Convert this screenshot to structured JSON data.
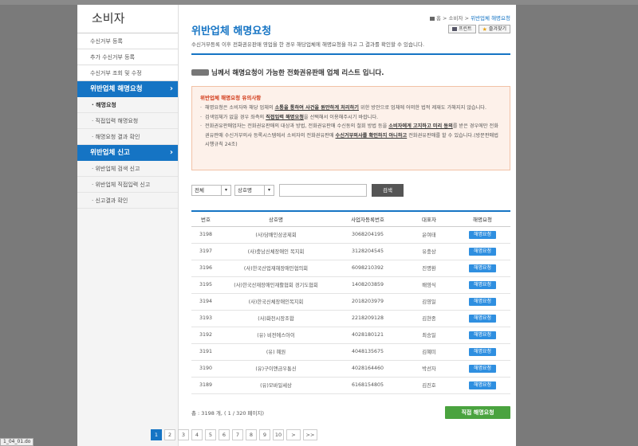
{
  "sidebar": {
    "title": "소비자",
    "items": [
      "수신거부 등록",
      "추가 수신거부 등록",
      "수신거부 조회 및 수정"
    ],
    "section1": "위반업체 해명요청",
    "section1_subs": [
      "· 해명요청",
      "· 직접입력 해명요청",
      "· 해명요청 결과 확인"
    ],
    "section2": "위반업체 신고",
    "section2_subs": [
      "· 위반업체 검색 신고",
      "· 위반업체 직접입력 신고",
      "· 신고결과 확인"
    ]
  },
  "breadcrumb": {
    "home": "홈",
    "sep": ">",
    "level1": "소비자",
    "current": "위반업체 해명요청"
  },
  "header": {
    "title": "위반업체 해명요청",
    "print_label": "프린트",
    "favorite_label": "즐겨찾기",
    "description": "수신거부등록 이후 전화권유판매 영업을 한 경우 해당업체에 해명요청을 하고 그 결과를 확인할 수 있습니다."
  },
  "notice_heading": "님께서 해명요청이 가능한 전화권유판매 업체 리스트 입니다.",
  "notice": {
    "title": "위반업체 해명요청 유의사항",
    "item1": {
      "a": "해명요청은 소비자와 해당 업체의 ",
      "b": "소통을 통하여 사건을 원만하게 처리하기",
      "c": " 위한 방안으로 업체에 어떠한 법적 제재도 가해지지 않습니다."
    },
    "item2": {
      "a": "검색업체가 없을 경우 좌측의 ",
      "b": "직접입력 해명요청",
      "c": "을 선택해서 이용해주시기 바랍니다."
    },
    "item3": {
      "a": "전화권유판매업자는 전화권유판매의 대상과 방법, 전화권유판매 수신동의 철회 방법 등을 ",
      "b": "소비자에게 고지하고 미리 동의",
      "c": "를 받은 경우에만 전화권유판매 수신거부의사 등록시스템에서 소비자의 전화권유판매 ",
      "d": "수신거부의사를 확인하지 아니하고",
      "e": " 전화권유판매를 할 수 있습니다.(방문판매법 시행규칙 24조)"
    }
  },
  "search": {
    "scope": "전체",
    "field": "상호명",
    "button": "검색"
  },
  "table": {
    "headers": [
      "번호",
      "상호명",
      "사업자등록번호",
      "대표자",
      "해명요청"
    ],
    "button_label": "해명요청",
    "rows": [
      [
        "3198",
        "(사)담배인삼공제회",
        "3068204195",
        "윤여태"
      ],
      [
        "3197",
        "(사)충남신체장애인 복지회",
        "3128204545",
        "유충상"
      ],
      [
        "3196",
        "(사)한국산업재해장애인협의회",
        "6098210392",
        "진명환"
      ],
      [
        "3195",
        "(사)한국산재장애인재활협회 경기도협회",
        "1408203859",
        "배영식"
      ],
      [
        "3194",
        "(사)한국신체장애인복지회",
        "2018203979",
        "김영일"
      ],
      [
        "3193",
        "(사)화천시장조합",
        "2218209128",
        "김현종"
      ],
      [
        "3192",
        "(유) 비전에스아이",
        "4028180121",
        "최승일"
      ],
      [
        "3191",
        "(유) 혜원",
        "4048135675",
        "김혜미"
      ],
      [
        "3190",
        "(유)구이앤금우통신",
        "4028164460",
        "박선자"
      ],
      [
        "3189",
        "(유)모바일세상",
        "6168154805",
        "김진호"
      ]
    ]
  },
  "footer": {
    "total": "총 : 3198 개, ( 1 / 320 페이지)",
    "direct_button": "직접 해명요청",
    "pages": [
      "1",
      "2",
      "3",
      "4",
      "5",
      "6",
      "7",
      "8",
      "9",
      "10"
    ],
    "next": ">",
    "last": ">>"
  },
  "statusbar": "1_04_01.do"
}
